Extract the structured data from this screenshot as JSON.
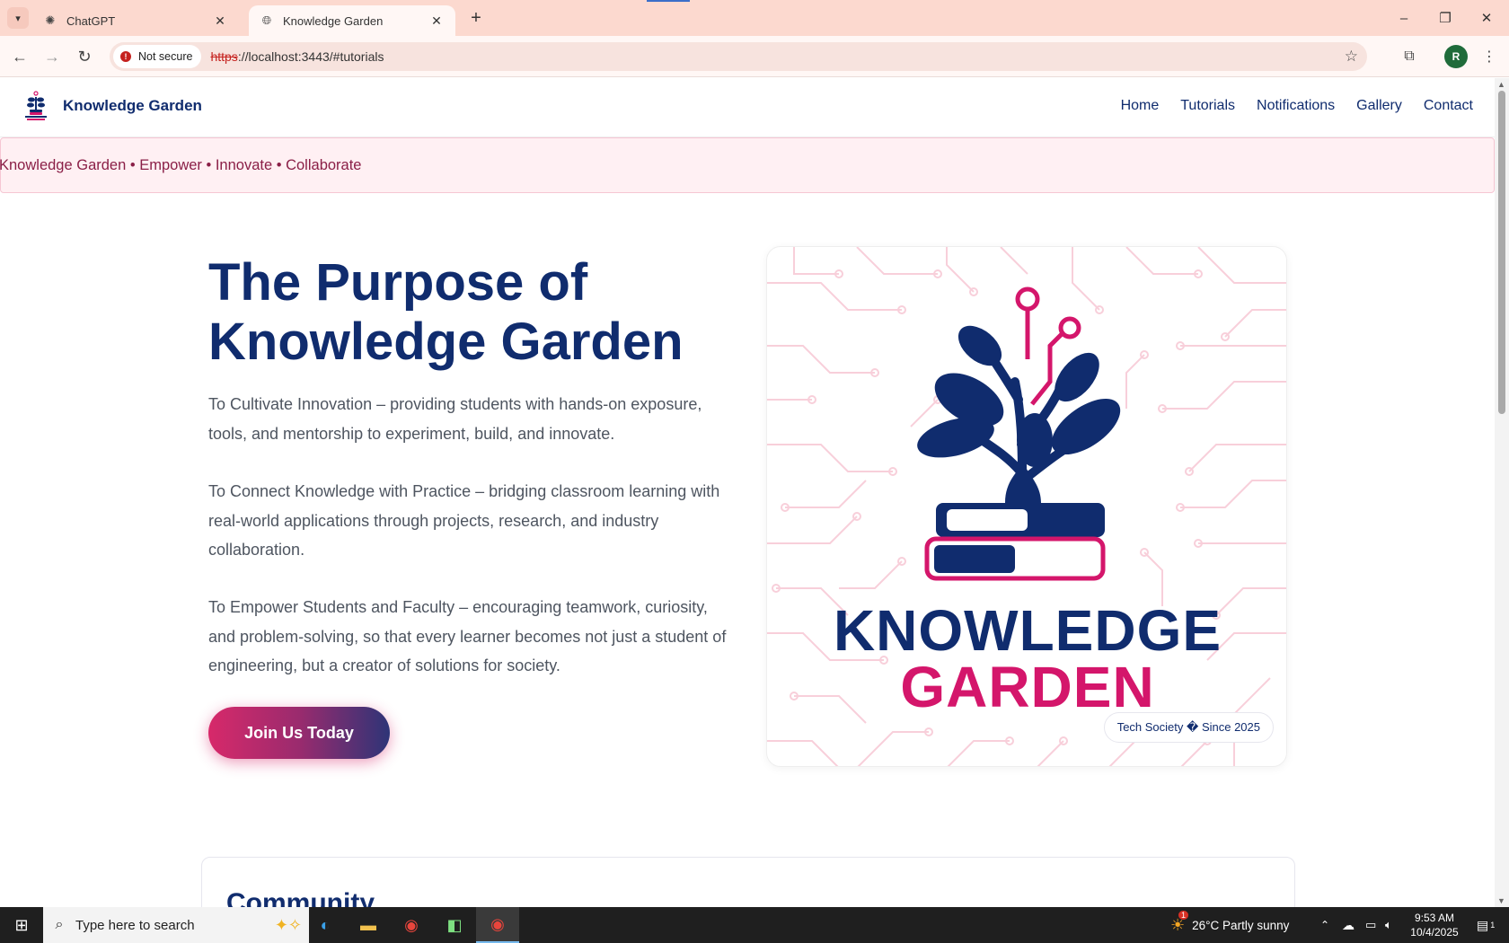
{
  "browser": {
    "tabs": [
      {
        "title": "ChatGPT",
        "active": false
      },
      {
        "title": "Knowledge Garden",
        "active": true
      }
    ],
    "security_label": "Not secure",
    "url_scheme": "https",
    "url_rest": "://localhost:3443/#tutorials",
    "profile_initial": "R"
  },
  "site": {
    "brand": "Knowledge Garden",
    "nav": [
      "Home",
      "Tutorials",
      "Notifications",
      "Gallery",
      "Contact"
    ],
    "ticker": "Knowledge Garden • Empower • Innovate • Collaborate",
    "hero": {
      "title_line1": "The Purpose of",
      "title_line2": "Knowledge Garden",
      "paragraphs": [
        "To Cultivate Innovation – providing students with hands-on exposure, tools, and mentorship to experiment, build, and innovate.",
        "To Connect Knowledge with Practice – bridging classroom learning with real-world applications through projects, research, and industry collaboration.",
        "To Empower Students and Faculty – encouraging teamwork, curiosity, and problem-solving, so that every learner becomes not just a student of engineering, but a creator of solutions for society."
      ],
      "cta": "Join Us Today"
    },
    "logo": {
      "word1": "KNOWLEDGE",
      "word2": "GARDEN",
      "badge": "Tech Society � Since 2025"
    },
    "community_title": "Community"
  },
  "taskbar": {
    "search_placeholder": "Type here to search",
    "weather": "26°C  Partly sunny",
    "weather_badge": "1",
    "time": "9:53 AM",
    "date": "10/4/2025",
    "notif_count": "1"
  },
  "colors": {
    "navy": "#102c6e",
    "pink": "#d4166b",
    "tabbar": "#fcd9cf"
  }
}
